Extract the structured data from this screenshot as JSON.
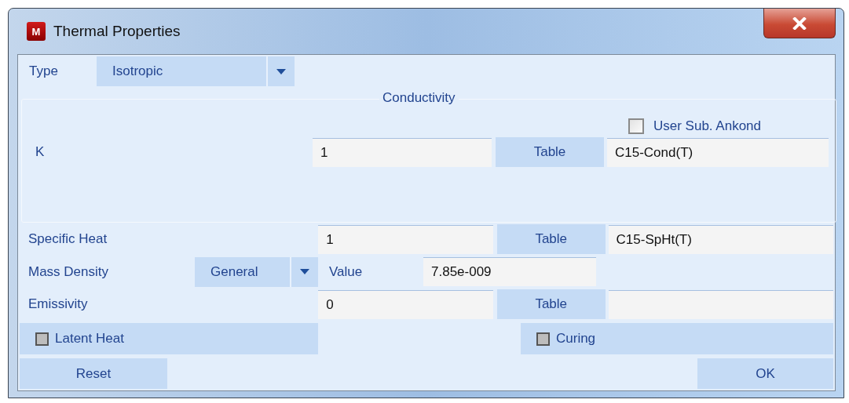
{
  "window": {
    "title": "Thermal Properties",
    "app_icon": "M"
  },
  "type": {
    "label": "Type",
    "value": "Isotropic"
  },
  "conductivity": {
    "title": "Conductivity",
    "user_sub": {
      "label": "User Sub. Ankond",
      "checked": false
    },
    "k": {
      "label": "K",
      "value": "1",
      "button": "Table",
      "table": "C15-Cond(T)"
    }
  },
  "properties": [
    {
      "kind": "table",
      "label": "Specific Heat",
      "value": "1",
      "button": "Table",
      "table": "C15-SpHt(T)"
    },
    {
      "kind": "combo",
      "label": "Mass Density",
      "option": "General",
      "value_label": "Value",
      "value": "7.85e-009"
    },
    {
      "kind": "table",
      "label": "Emissivity",
      "value": "0",
      "button": "Table"
    }
  ],
  "toggles": [
    {
      "label": "Latent Heat",
      "checked": false
    },
    {
      "label": "Curing",
      "checked": false
    }
  ],
  "buttons": [
    "Reset",
    "OK"
  ]
}
